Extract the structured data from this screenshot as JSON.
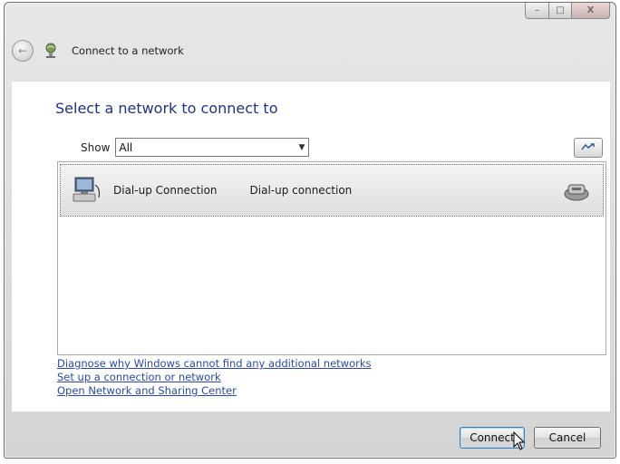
{
  "window": {
    "caption_buttons": {
      "minimize": "–",
      "maximize": "□",
      "close": "X"
    }
  },
  "nav": {
    "back_glyph": "←",
    "title": "Connect to a network",
    "icon": "network-icon"
  },
  "main": {
    "heading": "Select a network to connect to",
    "show_label": "Show",
    "show_value": "All",
    "refresh_icon": "refresh-icon",
    "networks": [
      {
        "name": "Dial-up Connection",
        "type": "Dial-up connection",
        "icon": "dialup-icon",
        "status_icon": "modem-icon"
      }
    ],
    "links": [
      "Diagnose why Windows cannot find any additional networks",
      "Set up a connection or network",
      "Open Network and Sharing Center"
    ]
  },
  "footer": {
    "connect_label": "Connect",
    "cancel_label": "Cancel"
  }
}
